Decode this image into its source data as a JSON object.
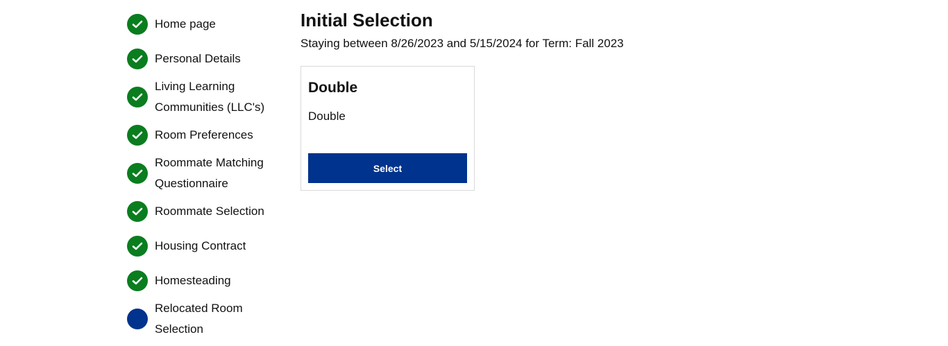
{
  "sidebar": {
    "steps": [
      {
        "label": "Home page",
        "status": "complete",
        "icon": "check-icon"
      },
      {
        "label": "Personal Details",
        "status": "complete",
        "icon": "check-icon"
      },
      {
        "label": "Living Learning Communities (LLC's)",
        "status": "complete",
        "icon": "check-icon"
      },
      {
        "label": "Room Preferences",
        "status": "complete",
        "icon": "check-icon"
      },
      {
        "label": "Roommate Matching Questionnaire",
        "status": "complete",
        "icon": "check-icon"
      },
      {
        "label": "Roommate Selection",
        "status": "complete",
        "icon": "check-icon"
      },
      {
        "label": "Housing Contract",
        "status": "complete",
        "icon": "check-icon"
      },
      {
        "label": "Homesteading",
        "status": "complete",
        "icon": "check-icon"
      },
      {
        "label": "Relocated Room Selection",
        "status": "current",
        "icon": "current-step-icon"
      }
    ]
  },
  "main": {
    "title": "Initial Selection",
    "stay_text": "Staying between 8/26/2023 and 5/15/2024 for Term: Fall 2023",
    "room_card": {
      "title": "Double",
      "description": "Double",
      "select_label": "Select"
    }
  },
  "colors": {
    "complete": "#0a7d1f",
    "current": "#00338d",
    "button": "#00338d"
  }
}
